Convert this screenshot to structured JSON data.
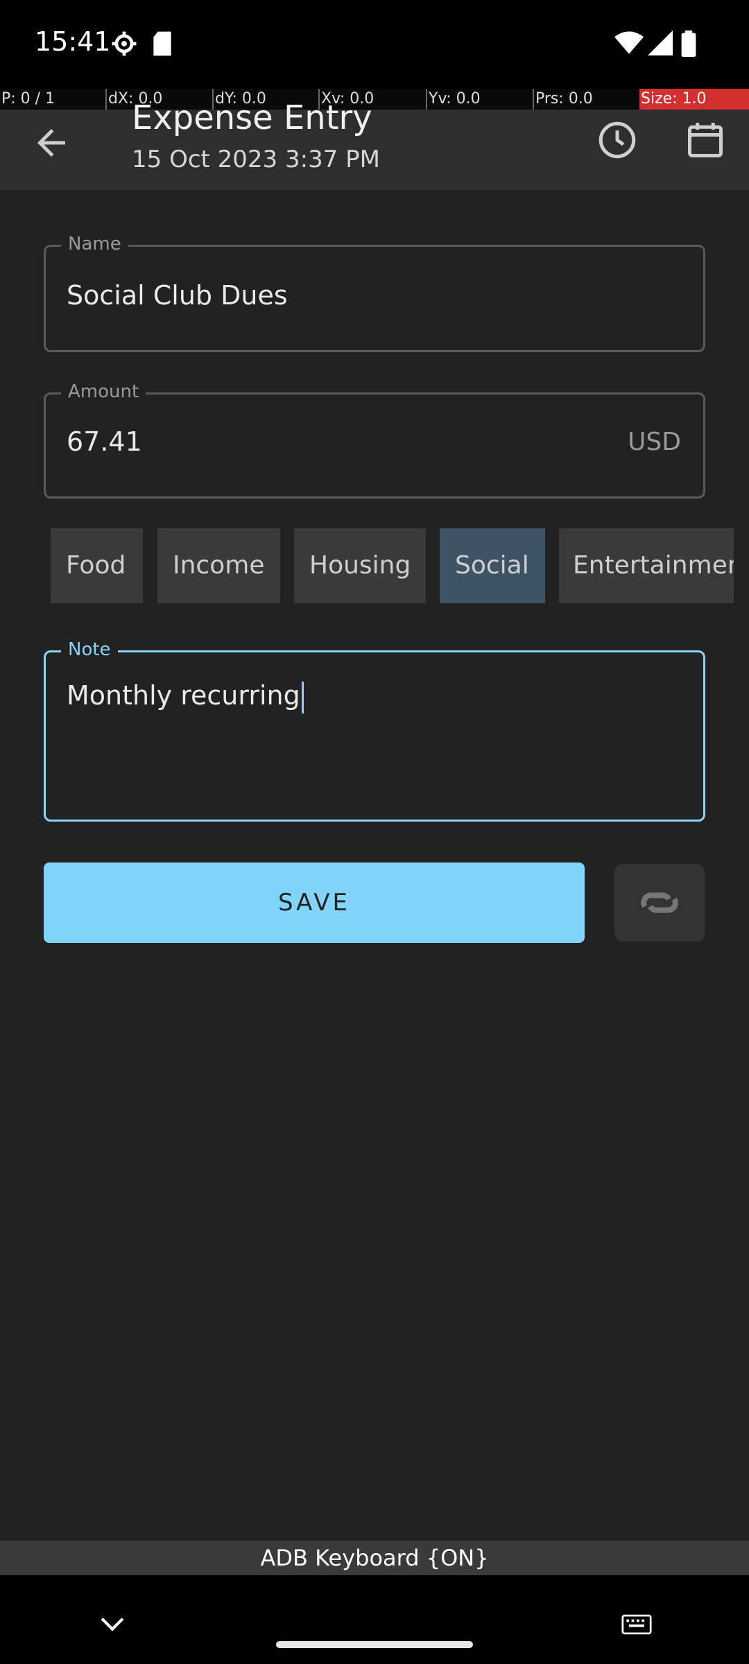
{
  "status_bar": {
    "time": "15:41",
    "icons": [
      "settings-icon",
      "sd-card-icon",
      "wifi-icon",
      "signal-icon",
      "battery-icon"
    ]
  },
  "debug_bar": {
    "p": "P: 0 / 1",
    "dx": "dX: 0.0",
    "dy": "dY: 0.0",
    "xv": "Xv: 0.0",
    "yv": "Yv: 0.0",
    "prs": "Prs: 0.0",
    "size": "Size: 1.0"
  },
  "app_bar": {
    "title": "Expense Entry",
    "subtitle": "15 Oct 2023 3:37 PM",
    "icons": [
      "back-arrow-icon",
      "clock-icon",
      "calendar-icon"
    ]
  },
  "form": {
    "name": {
      "label": "Name",
      "value": "Social Club Dues"
    },
    "amount": {
      "label": "Amount",
      "value": "67.41",
      "currency": "USD"
    },
    "categories": [
      {
        "label": "Food",
        "selected": false
      },
      {
        "label": "Income",
        "selected": false
      },
      {
        "label": "Housing",
        "selected": false
      },
      {
        "label": "Social",
        "selected": true
      },
      {
        "label": "Entertainment",
        "selected": false
      }
    ],
    "note": {
      "label": "Note",
      "value": "Monthly recurring"
    }
  },
  "actions": {
    "save_label": "SAVE",
    "aux_icon": "recurring-link-icon"
  },
  "keyboard_bar": {
    "label": "ADB Keyboard {ON}"
  },
  "nav_bar": {
    "icons": [
      "chevron-down-icon",
      "keyboard-icon"
    ]
  },
  "colors": {
    "accent": "#81d4fa",
    "selected_chip": "#3e5366",
    "background": "#222222"
  }
}
